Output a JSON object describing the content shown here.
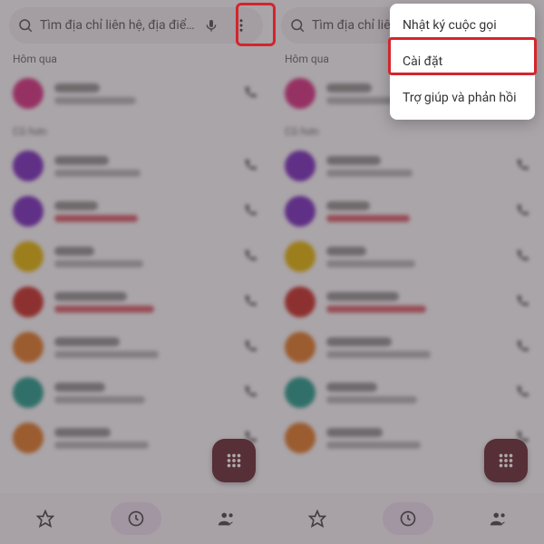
{
  "search": {
    "placeholder": "Tìm địa chỉ liên hệ, địa điểm"
  },
  "sections": {
    "yesterday": "Hôm qua",
    "older": "Cũ hơn"
  },
  "menu": {
    "history": "Nhật ký cuộc gọi",
    "settings": "Cài đặt",
    "help": "Trợ giúp và phản hồi"
  },
  "icons": {
    "search": "search-icon",
    "mic": "mic-icon",
    "more": "more-vert-icon",
    "call": "call-icon",
    "star": "star-icon",
    "recents": "clock-icon",
    "contacts": "people-icon",
    "dialpad": "dialpad-icon"
  },
  "colors": {
    "highlight": "#d4252c",
    "fab": "#6b2d38"
  }
}
